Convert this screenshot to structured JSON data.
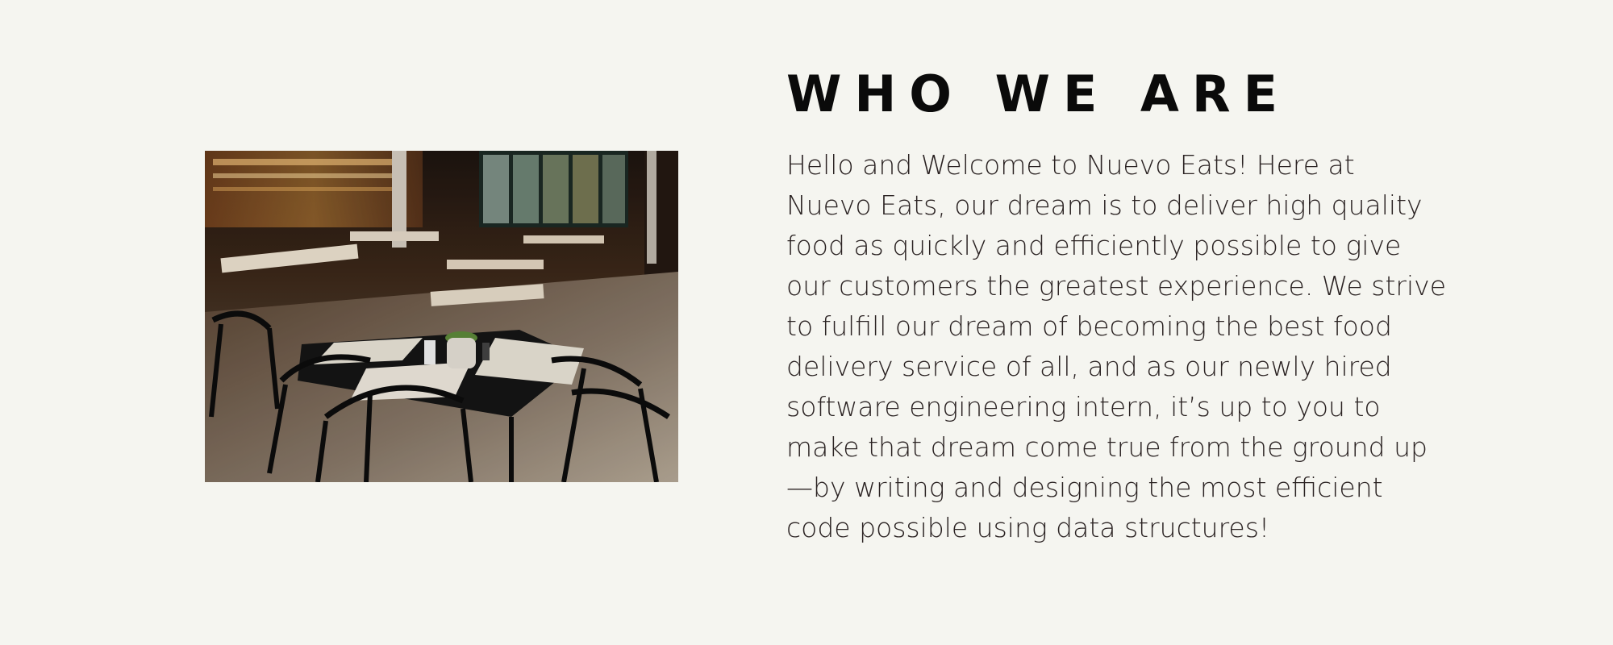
{
  "section": {
    "heading": "WHO WE ARE",
    "paragraph_lines": [
      "Hello and Welcome to Nuevo Eats! Here at",
      "Nuevo Eats, our dream is to deliver high quality",
      "food as quickly and efficiently possible to give",
      "our customers the greatest experience. We strive",
      "to fulfill our dream of becoming the best food",
      "delivery service of all, and as our newly hired",
      "software engineering intern, it’s up to you to",
      "make that dream come true from the ground up",
      "—by writing and designing the most efficient",
      "code possible using data structures!"
    ]
  },
  "colors": {
    "background": "#f5f5f0",
    "heading": "#0a0a0a",
    "text": "#2a2222"
  }
}
